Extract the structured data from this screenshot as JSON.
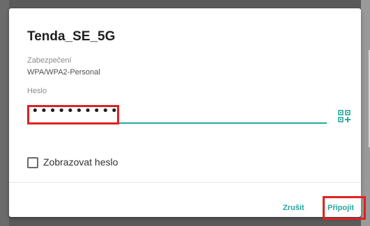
{
  "dialog": {
    "title": "Tenda_SE_5G",
    "security_label": "Zabezpečení",
    "security_value": "WPA/WPA2-Personal",
    "password_label": "Heslo",
    "password_value": "••••••••••",
    "qr_icon": "qr-code-icon",
    "show_password_label": "Zobrazovat heslo",
    "show_password_checked": false,
    "cancel_label": "Zrušit",
    "connect_label": "Připojit"
  },
  "colors": {
    "accent": "#26a69a",
    "highlight": "#e02020"
  }
}
